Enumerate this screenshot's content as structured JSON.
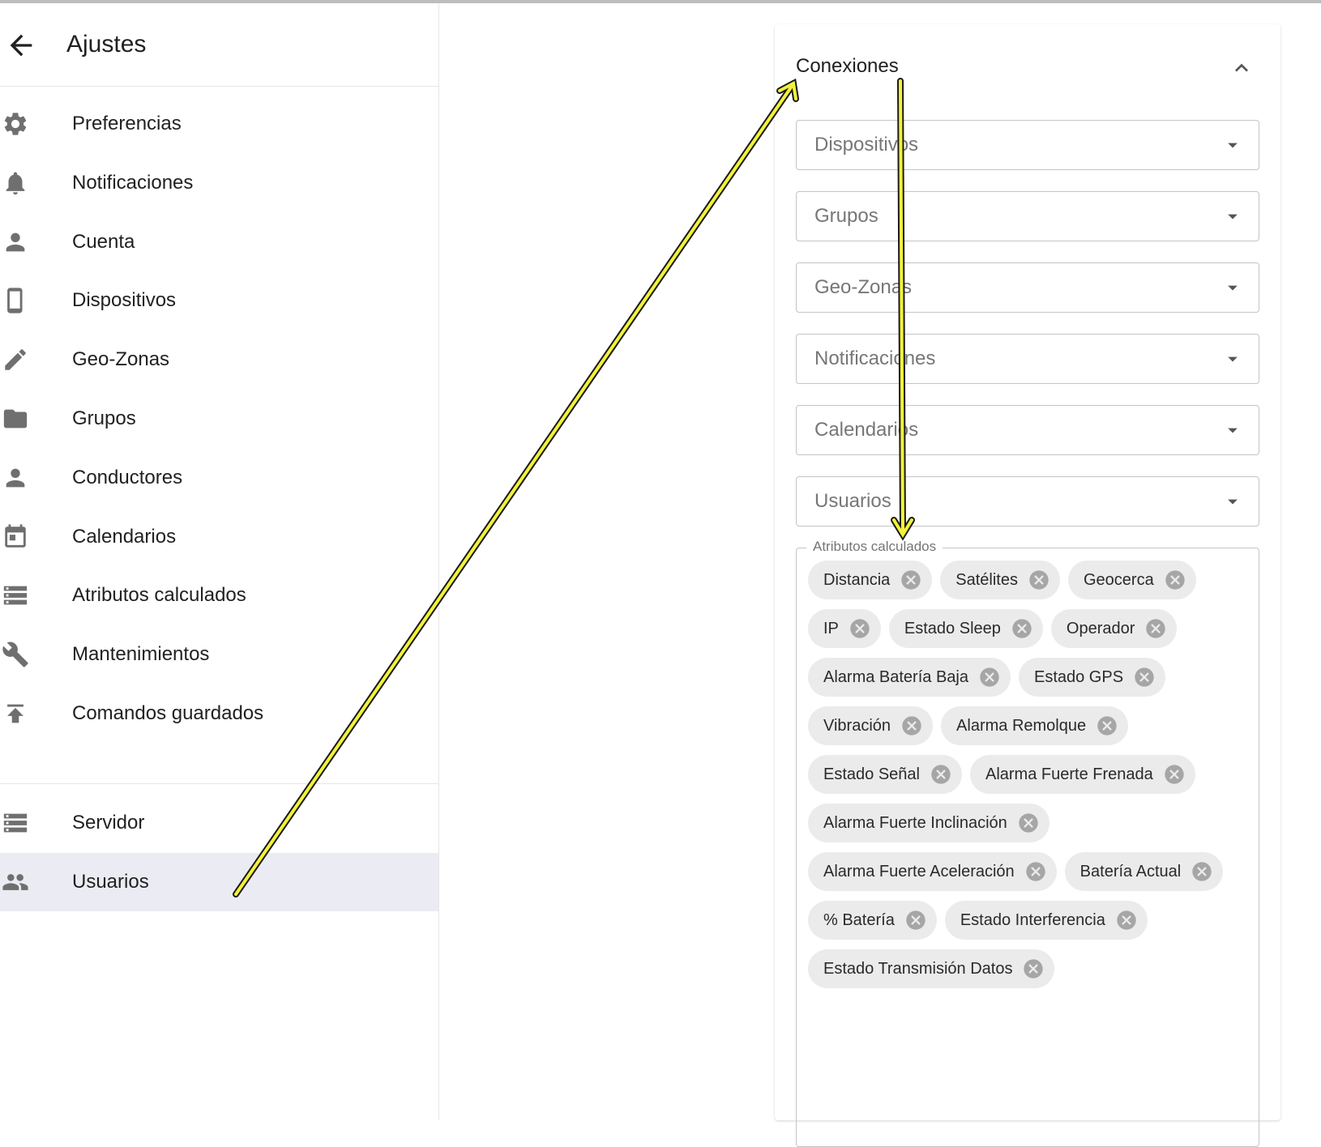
{
  "header": {
    "title": "Ajustes",
    "back_icon": "arrow-back-icon"
  },
  "sidebar": {
    "items": [
      {
        "label": "Preferencias",
        "icon": "gear-icon"
      },
      {
        "label": "Notificaciones",
        "icon": "bell-icon"
      },
      {
        "label": "Cuenta",
        "icon": "person-icon"
      },
      {
        "label": "Dispositivos",
        "icon": "phone-icon"
      },
      {
        "label": "Geo-Zonas",
        "icon": "pencil-icon"
      },
      {
        "label": "Grupos",
        "icon": "folder-icon"
      },
      {
        "label": "Conductores",
        "icon": "person-icon"
      },
      {
        "label": "Calendarios",
        "icon": "calendar-icon"
      },
      {
        "label": "Atributos calculados",
        "icon": "list-icon"
      },
      {
        "label": "Mantenimientos",
        "icon": "wrench-icon"
      },
      {
        "label": "Comandos guardados",
        "icon": "publish-icon"
      }
    ],
    "bottom_items": [
      {
        "label": "Servidor",
        "icon": "storage-icon"
      },
      {
        "label": "Usuarios",
        "icon": "people-icon",
        "selected": true
      }
    ]
  },
  "panel": {
    "title": "Conexiones",
    "selects": [
      {
        "label": "Dispositivos"
      },
      {
        "label": "Grupos"
      },
      {
        "label": "Geo-Zonas"
      },
      {
        "label": "Notificaciones"
      },
      {
        "label": "Calendarios"
      },
      {
        "label": "Usuarios"
      }
    ],
    "attributes": {
      "legend": "Atributos calculados",
      "chips": [
        "Distancia",
        "Satélites",
        "Geocerca",
        "IP",
        "Estado Sleep",
        "Operador",
        "Alarma Batería Baja",
        "Estado GPS",
        "Vibración",
        "Alarma Remolque",
        "Estado Señal",
        "Alarma Fuerte Frenada",
        "Alarma Fuerte Inclinación",
        "Alarma Fuerte Aceleración",
        "Batería Actual",
        "% Batería",
        "Estado Interferencia",
        "Estado Transmisión Datos"
      ]
    }
  },
  "colors": {
    "selected_bg": "#ebebf3",
    "annotation_arrow": "#f2f23a"
  }
}
